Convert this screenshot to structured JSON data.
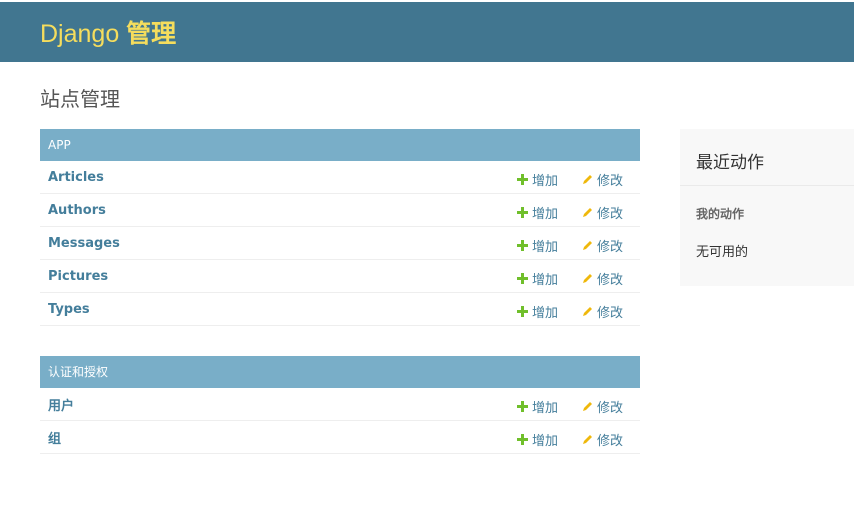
{
  "header": {
    "brand_main": "Django ",
    "brand_strong": "管理"
  },
  "page_title": "站点管理",
  "modules": [
    {
      "caption": "APP",
      "models": [
        {
          "name": "Articles",
          "add": "增加",
          "change": "修改"
        },
        {
          "name": "Authors",
          "add": "增加",
          "change": "修改"
        },
        {
          "name": "Messages",
          "add": "增加",
          "change": "修改"
        },
        {
          "name": "Pictures",
          "add": "增加",
          "change": "修改"
        },
        {
          "name": "Types",
          "add": "增加",
          "change": "修改"
        }
      ]
    },
    {
      "caption": "认证和授权",
      "models": [
        {
          "name": "用户",
          "add": "增加",
          "change": "修改"
        },
        {
          "name": "组",
          "add": "增加",
          "change": "修改"
        }
      ]
    }
  ],
  "recent_actions": {
    "title": "最近动作",
    "subtitle": "我的动作",
    "empty_text": "无可用的"
  },
  "colors": {
    "header_bg": "#417690",
    "brand": "#f5dd5d",
    "caption_bg": "#79aec8",
    "link": "#447e9b",
    "add_icon": "#70bf2b",
    "change_icon": "#efb80b"
  },
  "icons": {
    "add": "plus-icon",
    "change": "pencil-icon"
  }
}
